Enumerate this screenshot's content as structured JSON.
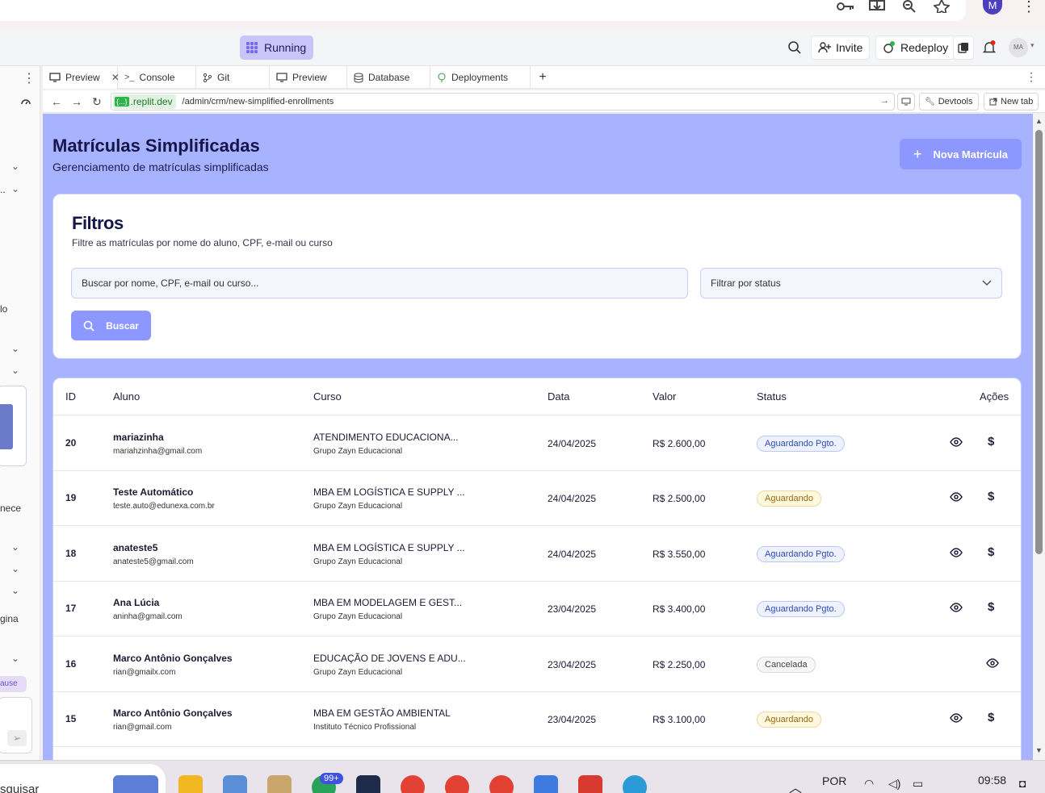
{
  "browser": {
    "profile_initial": "M"
  },
  "replit": {
    "running_label": "Running",
    "invite_label": "Invite",
    "redeploy_label": "Redeploy",
    "avatar_initials": "MA"
  },
  "tabs": [
    {
      "label": "Preview",
      "icon": "monitor-icon"
    },
    {
      "label": "Console",
      "icon": "terminal-icon"
    },
    {
      "label": "Git",
      "icon": "git-icon"
    },
    {
      "label": "Preview",
      "icon": "monitor-icon"
    },
    {
      "label": "Database",
      "icon": "database-icon"
    },
    {
      "label": "Deployments",
      "icon": "deploy-icon"
    }
  ],
  "address": {
    "host_badge": "{...}",
    "host": ".replit.dev",
    "path": "/admin/crm/new-simplified-enrollments",
    "devtools_label": "Devtools",
    "newtab_label": "New tab"
  },
  "sidebar_fragments": [
    "lo",
    "nece",
    "gina",
    "ause"
  ],
  "page": {
    "title": "Matrículas Simplificadas",
    "subtitle": "Gerenciamento de matrículas simplificadas",
    "new_button": "Nova Matrícula"
  },
  "filters": {
    "title": "Filtros",
    "subtitle": "Filtre as matrículas por nome do aluno, CPF, e-mail ou curso",
    "search_placeholder": "Buscar por nome, CPF, e-mail ou curso...",
    "status_placeholder": "Filtrar por status",
    "search_button": "Buscar"
  },
  "table": {
    "headers": {
      "id": "ID",
      "aluno": "Aluno",
      "curso": "Curso",
      "data": "Data",
      "valor": "Valor",
      "status": "Status",
      "acoes": "Ações"
    },
    "rows": [
      {
        "id": "20",
        "name": "mariazinha",
        "email": "mariahzinha@gmail.com",
        "course": "ATENDIMENTO EDUCACIONA...",
        "org": "Grupo Zayn Educacional",
        "date": "24/04/2025",
        "value": "R$ 2.600,00",
        "status": "Aguardando Pgto."
      },
      {
        "id": "19",
        "name": "Teste Automático",
        "email": "teste.auto@edunexa.com.br",
        "course": "MBA EM LOGÍSTICA E SUPPLY ...",
        "org": "Grupo Zayn Educacional",
        "date": "24/04/2025",
        "value": "R$ 2.500,00",
        "status": "Aguardando"
      },
      {
        "id": "18",
        "name": "anateste5",
        "email": "anateste5@gmail.com",
        "course": "MBA EM LOGÍSTICA E SUPPLY ...",
        "org": "Grupo Zayn Educacional",
        "date": "24/04/2025",
        "value": "R$ 3.550,00",
        "status": "Aguardando Pgto."
      },
      {
        "id": "17",
        "name": "Ana Lúcia",
        "email": "aninha@gmail.com",
        "course": "MBA EM MODELAGEM E GEST...",
        "org": "Grupo Zayn Educacional",
        "date": "23/04/2025",
        "value": "R$ 3.400,00",
        "status": "Aguardando Pgto."
      },
      {
        "id": "16",
        "name": "Marco Antônio Gonçalves",
        "email": "rian@gmailx.com",
        "course": "EDUCAÇÃO DE JOVENS E ADU...",
        "org": "Grupo Zayn Educacional",
        "date": "23/04/2025",
        "value": "R$ 2.250,00",
        "status": "Cancelada"
      },
      {
        "id": "15",
        "name": "Marco Antônio Gonçalves",
        "email": "rian@gmail.com",
        "course": "MBA EM GESTÃO AMBIENTAL",
        "org": "Instituto Técnico Profissional",
        "date": "23/04/2025",
        "value": "R$ 3.100,00",
        "status": "Aguardando"
      }
    ]
  },
  "taskbar": {
    "search_text": "squisar",
    "badge": "99+",
    "language": "POR",
    "time": "09:58"
  },
  "colors": {
    "page_bg": "#a8b3ff",
    "accent": "#8c98ff",
    "title": "#17164a"
  }
}
